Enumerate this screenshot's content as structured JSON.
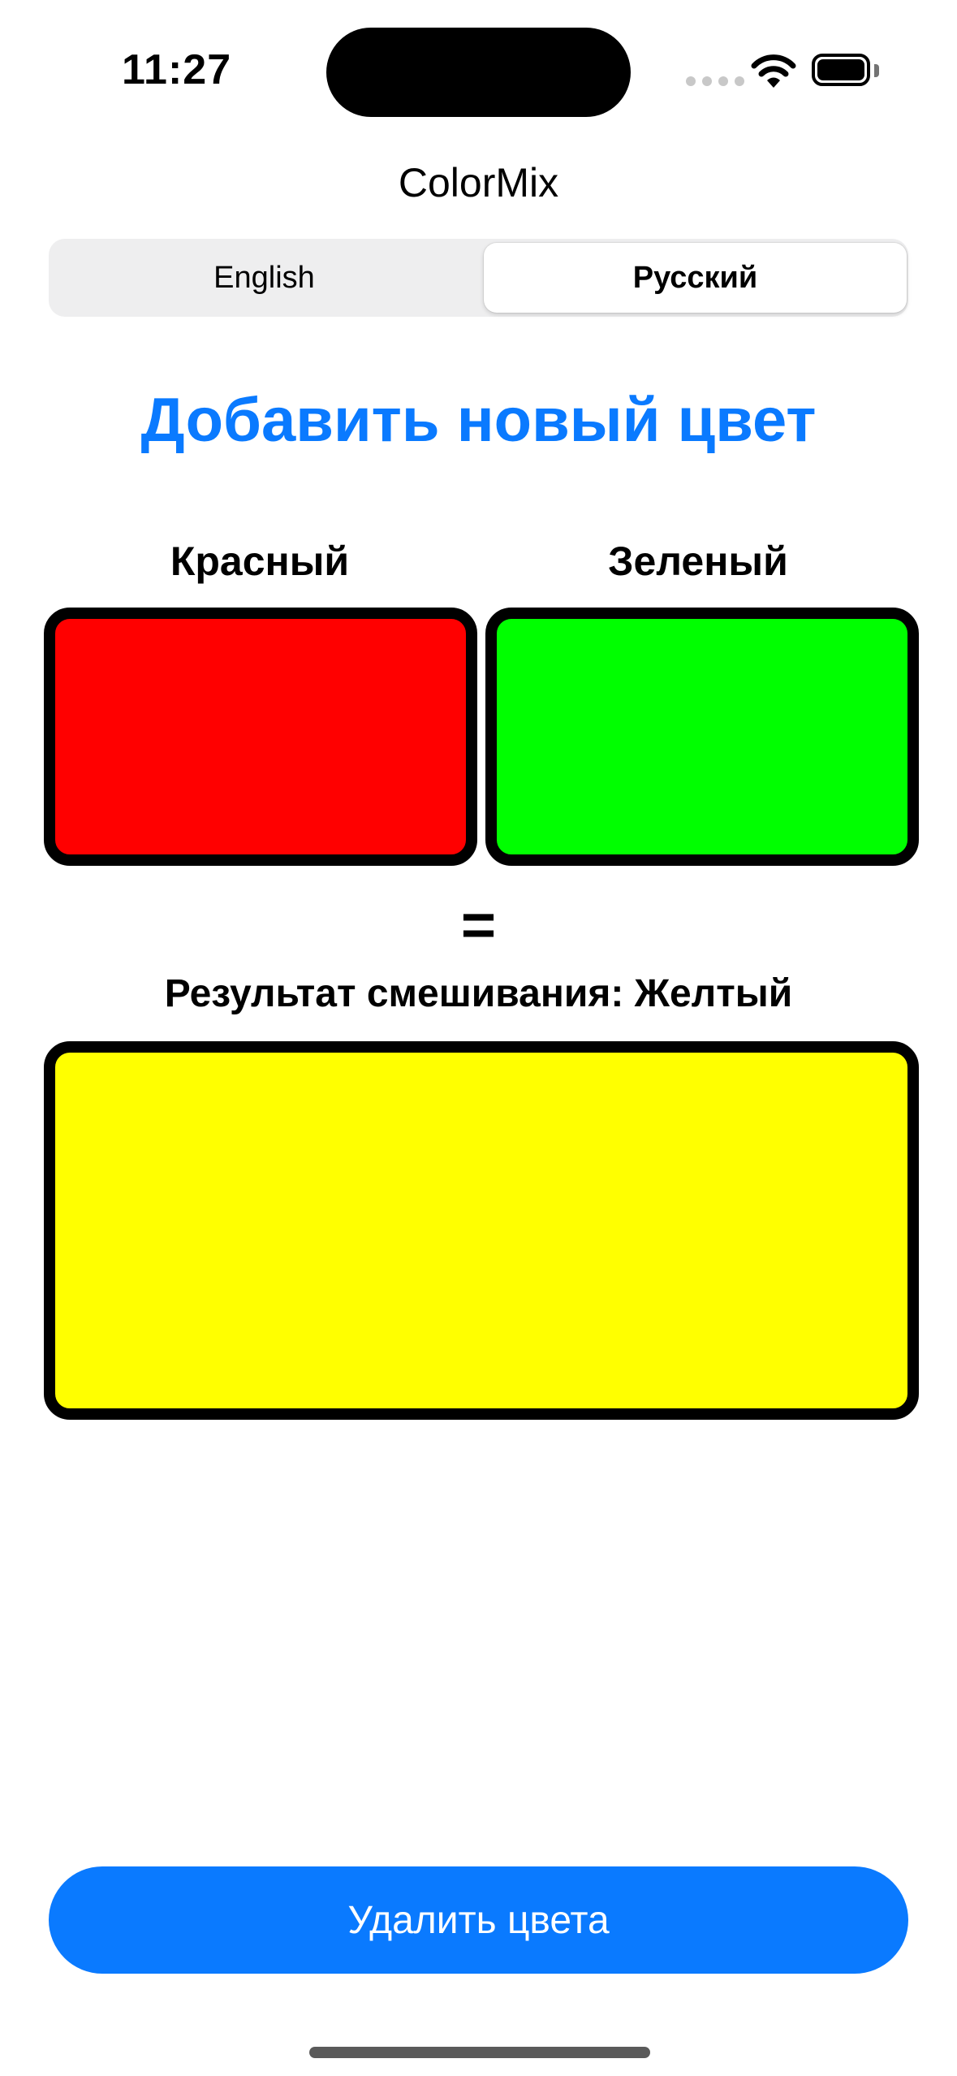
{
  "status_bar": {
    "time": "11:27"
  },
  "app": {
    "title": "ColorMix"
  },
  "language_selector": {
    "options": [
      "English",
      "Русский"
    ],
    "selected": "Русский"
  },
  "heading": "Добавить новый цвет",
  "colors": {
    "first": {
      "label": "Красный",
      "hex": "#ff0000"
    },
    "second": {
      "label": "Зеленый",
      "hex": "#00ff00"
    }
  },
  "equals_sign": "=",
  "result": {
    "label": "Результат смешивания: Желтый",
    "hex": "#ffff00"
  },
  "actions": {
    "delete_label": "Удалить цвета"
  },
  "theme": {
    "accent": "#0a7aff",
    "border": "#000000",
    "segmented_bg": "#eeeeef"
  }
}
